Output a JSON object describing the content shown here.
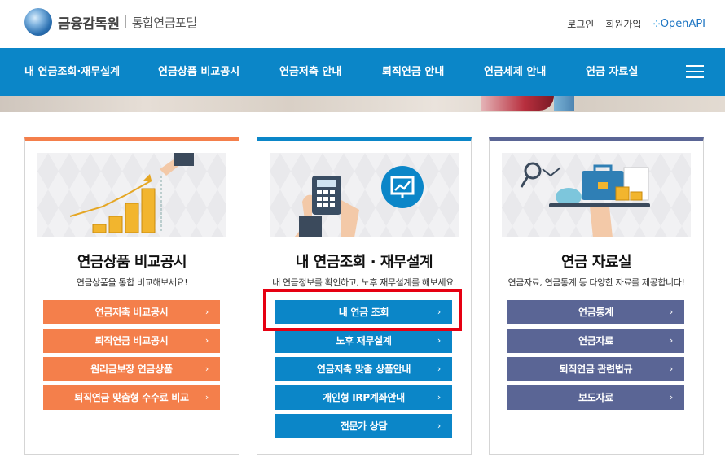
{
  "header": {
    "org_name": "금융감독원",
    "portal_name": "통합연금포털",
    "utility": {
      "login": "로그인",
      "signup": "회원가입",
      "openapi": "OpenAPI"
    }
  },
  "nav": {
    "items": [
      {
        "label": "내 연금조회·재무설계"
      },
      {
        "label": "연금상품 비교공시"
      },
      {
        "label": "연금저축 안내"
      },
      {
        "label": "퇴직연금 안내"
      },
      {
        "label": "연금세제 안내"
      },
      {
        "label": "연금 자료실"
      }
    ]
  },
  "cards": [
    {
      "title": "연금상품 비교공시",
      "desc": "연금상품을 통합 비교해보세요!",
      "accent": "#f47f4b",
      "buttons": [
        {
          "label": "연금저축 비교공시"
        },
        {
          "label": "퇴직연금 비교공시"
        },
        {
          "label": "원리금보장 연금상품"
        },
        {
          "label": "퇴직연금 맞춤형 수수료 비교"
        }
      ]
    },
    {
      "title": "내 연금조회 · 재무설계",
      "desc": "내 연금정보를 확인하고, 노후 재무설계를 해보세요.",
      "accent": "#0b86c8",
      "buttons": [
        {
          "label": "내 연금 조회"
        },
        {
          "label": "노후 재무설계"
        },
        {
          "label": "연금저축 맞춤 상품안내"
        },
        {
          "label": "개인형 IRP계좌안내"
        },
        {
          "label": "전문가 상담"
        }
      ]
    },
    {
      "title": "연금 자료실",
      "desc": "연금자료, 연금통계 등 다양한 자료를 제공합니다!",
      "accent": "#5a6595",
      "buttons": [
        {
          "label": "연금통계"
        },
        {
          "label": "연금자료"
        },
        {
          "label": "퇴직연금 관련법규"
        },
        {
          "label": "보도자료"
        }
      ]
    }
  ],
  "button_chevron": "›",
  "colors": {
    "nav_bg": "#0b86c8",
    "highlight": "#e60012"
  }
}
